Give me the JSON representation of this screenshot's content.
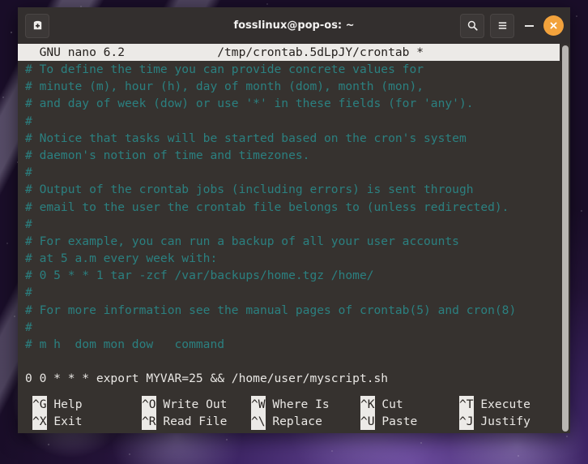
{
  "window": {
    "title": "fosslinux@pop-os: ~",
    "new_tab_icon": "new-terminal-icon",
    "search_icon": "search-icon",
    "menu_icon": "hamburger-menu-icon",
    "minimize_icon": "minimize-icon",
    "close_icon": "close-icon",
    "close_button_color": "#f2a23c",
    "titlebar_color": "#332f2e"
  },
  "nano": {
    "version_label": "GNU nano 6.2",
    "file_label": "/tmp/crontab.5dLpJY/crontab *",
    "header_line": "  GNU nano 6.2             /tmp/crontab.5dLpJY/crontab *",
    "comment_color": "#2b8080",
    "text_color": "#e9e7e4",
    "background_color": "#36322f",
    "lines": [
      {
        "text": "# To define the time you can provide concrete values for",
        "type": "comment"
      },
      {
        "text": "# minute (m), hour (h), day of month (dom), month (mon),",
        "type": "comment"
      },
      {
        "text": "# and day of week (dow) or use '*' in these fields (for 'any').",
        "type": "comment"
      },
      {
        "text": "#",
        "type": "comment"
      },
      {
        "text": "# Notice that tasks will be started based on the cron's system",
        "type": "comment"
      },
      {
        "text": "# daemon's notion of time and timezones.",
        "type": "comment"
      },
      {
        "text": "#",
        "type": "comment"
      },
      {
        "text": "# Output of the crontab jobs (including errors) is sent through",
        "type": "comment"
      },
      {
        "text": "# email to the user the crontab file belongs to (unless redirected).",
        "type": "comment"
      },
      {
        "text": "#",
        "type": "comment"
      },
      {
        "text": "# For example, you can run a backup of all your user accounts",
        "type": "comment"
      },
      {
        "text": "# at 5 a.m every week with:",
        "type": "comment"
      },
      {
        "text": "# 0 5 * * 1 tar -zcf /var/backups/home.tgz /home/",
        "type": "comment"
      },
      {
        "text": "#",
        "type": "comment"
      },
      {
        "text": "# For more information see the manual pages of crontab(5) and cron(8)",
        "type": "comment"
      },
      {
        "text": "#",
        "type": "comment"
      },
      {
        "text": "# m h  dom mon dow   command",
        "type": "comment"
      },
      {
        "text": "",
        "type": "blank"
      },
      {
        "text": "0 0 * * * export MYVAR=25 && /home/user/myscript.sh",
        "type": "command"
      }
    ],
    "shortcuts_row1": [
      {
        "key": "^G",
        "label": "Help"
      },
      {
        "key": "^O",
        "label": "Write Out"
      },
      {
        "key": "^W",
        "label": "Where Is"
      },
      {
        "key": "^K",
        "label": "Cut"
      },
      {
        "key": "^T",
        "label": "Execute"
      }
    ],
    "shortcuts_row2": [
      {
        "key": "^X",
        "label": "Exit"
      },
      {
        "key": "^R",
        "label": "Read File"
      },
      {
        "key": "^\\",
        "label": "Replace"
      },
      {
        "key": "^U",
        "label": "Paste"
      },
      {
        "key": "^J",
        "label": "Justify"
      }
    ]
  }
}
